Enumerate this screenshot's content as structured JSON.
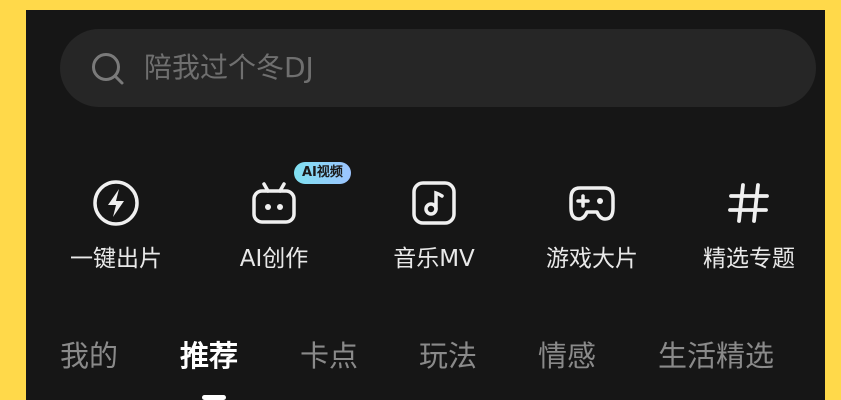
{
  "search": {
    "placeholder": "陪我过个冬DJ",
    "icon": "search-icon"
  },
  "tools": [
    {
      "label": "一键出片",
      "icon": "lightning-circle-icon"
    },
    {
      "label": "AI创作",
      "icon": "robot-icon",
      "badge": "AI视频"
    },
    {
      "label": "音乐MV",
      "icon": "music-note-icon"
    },
    {
      "label": "游戏大片",
      "icon": "gamepad-icon"
    },
    {
      "label": "精选专题",
      "icon": "hashtag-icon"
    }
  ],
  "tabs": [
    {
      "label": "我的"
    },
    {
      "label": "推荐",
      "active": true
    },
    {
      "label": "卡点"
    },
    {
      "label": "玩法"
    },
    {
      "label": "情感"
    },
    {
      "label": "生活精选"
    }
  ],
  "colors": {
    "frame": "#FFD94A",
    "background": "#161616",
    "search_bg": "#262626",
    "badge_gradient": [
      "#7fe0f0",
      "#9cc4ff"
    ]
  }
}
